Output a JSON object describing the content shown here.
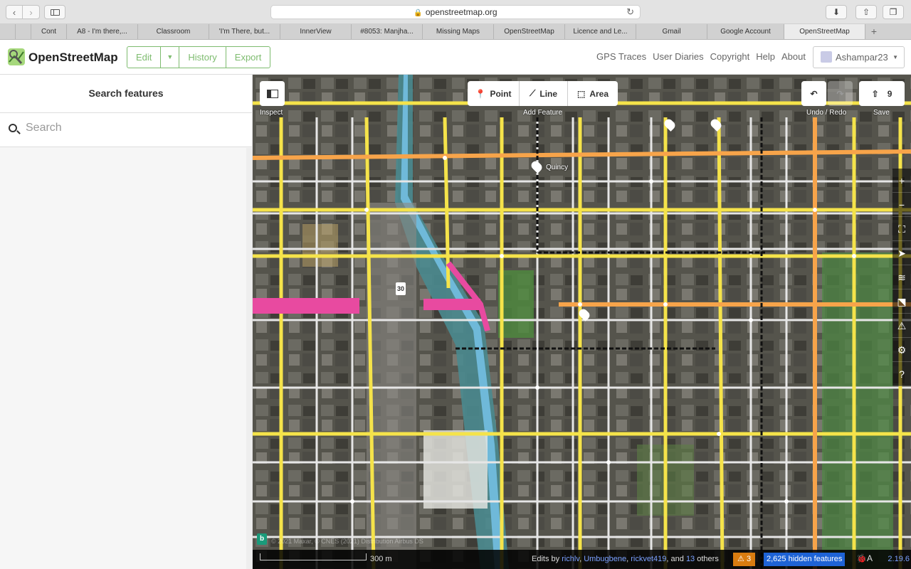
{
  "browser": {
    "url": "openstreetmap.org",
    "tabs": [
      "Cont",
      "A8 - I'm there,...",
      "Classroom",
      "'I'm There, but...",
      "InnerView",
      "#8053: Manjha...",
      "Missing Maps",
      "OpenStreetMap",
      "Licence and Le...",
      "Gmail",
      "Google Account",
      "OpenStreetMap"
    ],
    "new_tab": "+"
  },
  "header": {
    "brand": "OpenStreetMap",
    "edit": "Edit",
    "history": "History",
    "export": "Export",
    "links": [
      "GPS Traces",
      "User Diaries",
      "Copyright",
      "Help",
      "About"
    ],
    "user": "Ashampar23"
  },
  "sidebar": {
    "title": "Search features",
    "search_placeholder": "Search"
  },
  "map": {
    "inspect": "Inspect",
    "point": "Point",
    "line": "Line",
    "area": "Area",
    "add_feature": "Add Feature",
    "undo_redo": "Undo / Redo",
    "save_count": "9",
    "save": "Save",
    "street_label": "Quincy",
    "route_shield": "30",
    "scale": "300 m",
    "attribution": "© 2021 Maxar, © CNES (2021) Distribution Airbus DS",
    "edits_prefix": "Edits by",
    "editors": [
      "richlv",
      "Umbugbene",
      "rickvet419"
    ],
    "edits_and": "and",
    "others_count": "13",
    "others": "others",
    "issues_count": "3",
    "hidden_features": "2,625 hidden features",
    "version": "2.19.6",
    "colors": {
      "motorway": "#e84aa0",
      "primary": "#f7a44a",
      "secondary": "#f5e34a",
      "osm_green": "#7ebc6f"
    }
  }
}
